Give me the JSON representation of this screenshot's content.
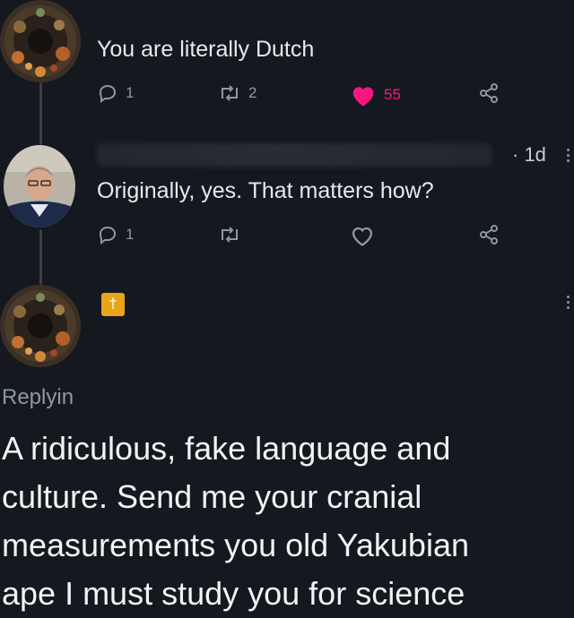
{
  "tweet1": {
    "text": "You are literally Dutch",
    "replies": "1",
    "retweets": "2",
    "likes": "55",
    "liked_color": "#f91880"
  },
  "tweet2": {
    "time": "· 1d",
    "text": "Originally, yes. That matters how?",
    "replies": "1"
  },
  "tweet3": {
    "badge_symbol": "†",
    "replying_label": "Replyin",
    "text_lines": [
      "A ridiculous, fake language and",
      "culture. Send me your cranial",
      "measurements you old Yakubian",
      "ape I must study you for science"
    ]
  },
  "icons": {
    "reply": "reply-icon",
    "retweet": "retweet-icon",
    "like": "heart-icon",
    "share": "share-icon"
  }
}
